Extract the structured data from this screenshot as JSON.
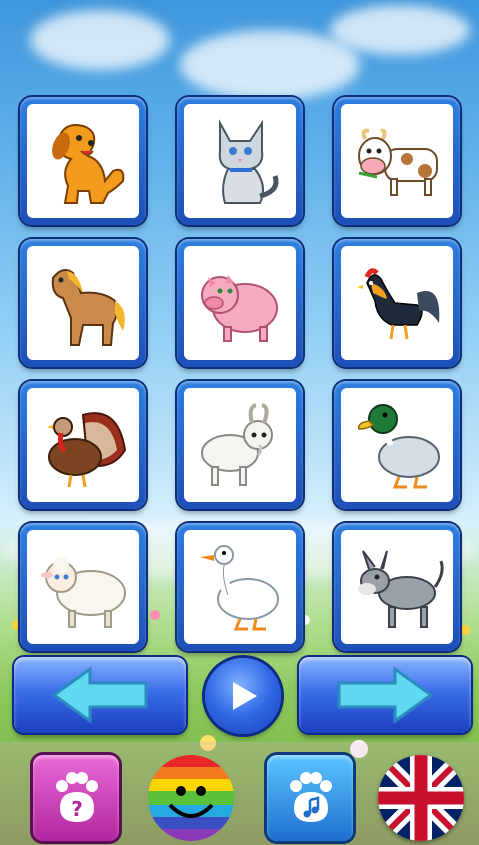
{
  "animals": [
    {
      "name": "dog",
      "icon": "dog-icon"
    },
    {
      "name": "cat",
      "icon": "cat-icon"
    },
    {
      "name": "cow",
      "icon": "cow-icon"
    },
    {
      "name": "horse",
      "icon": "horse-icon"
    },
    {
      "name": "pig",
      "icon": "pig-icon"
    },
    {
      "name": "rooster",
      "icon": "rooster-icon"
    },
    {
      "name": "turkey",
      "icon": "turkey-icon"
    },
    {
      "name": "goat",
      "icon": "goat-icon"
    },
    {
      "name": "duck",
      "icon": "duck-icon"
    },
    {
      "name": "sheep",
      "icon": "sheep-icon"
    },
    {
      "name": "goose",
      "icon": "goose-icon"
    },
    {
      "name": "donkey",
      "icon": "donkey-icon"
    }
  ],
  "navigation": {
    "previous_icon": "arrow-left-icon",
    "play_icon": "play-icon",
    "next_icon": "arrow-right-icon"
  },
  "bottom_bar": {
    "help_icon": "paw-question-icon",
    "colors_icon": "rainbow-smiley-icon",
    "sound_icon": "paw-music-icon",
    "language_icon": "uk-flag-icon"
  },
  "colors": {
    "tile_frame": "#1d4fb8",
    "nav_button": "#3a6ee8",
    "help_button": "#b2269f",
    "sound_button": "#1f6fcf",
    "arrow": "#5fd8f0"
  }
}
